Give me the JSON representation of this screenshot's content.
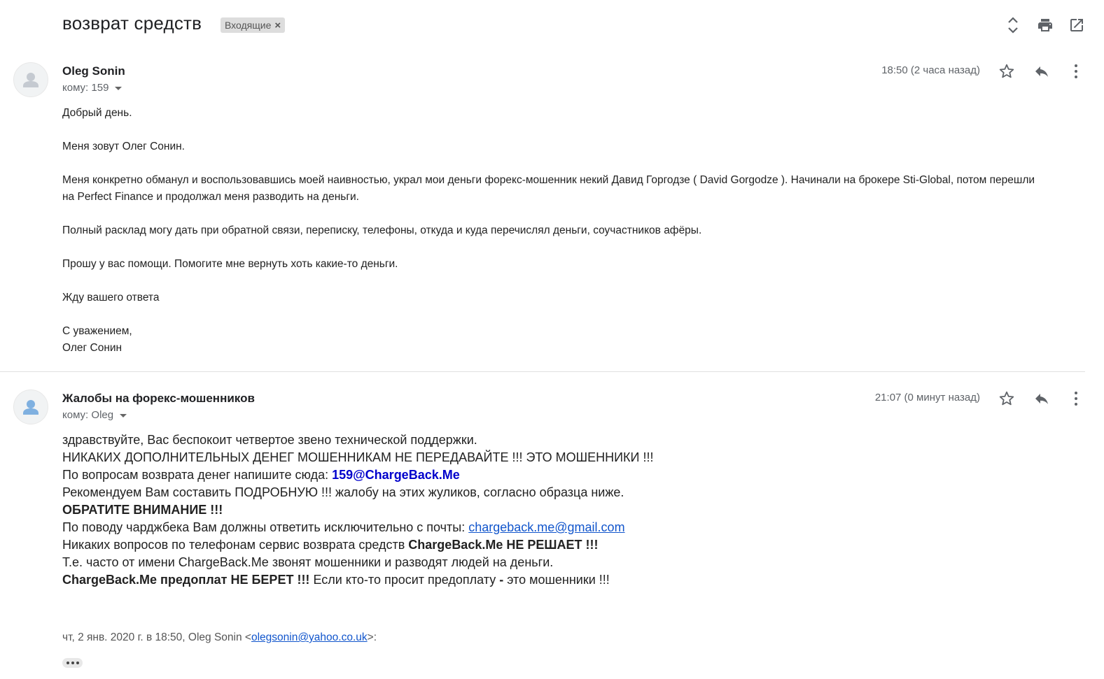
{
  "thread": {
    "subject": "возврат средств",
    "label": "Входящие",
    "label_remove": "×"
  },
  "header_icons": [
    "expand-collapse-icon",
    "print-icon",
    "open-in-new-window-icon"
  ],
  "messages": [
    {
      "sender": "Oleg Sonin",
      "to_prefix": "кому:",
      "to": "159",
      "time": "18:50 (2 часа назад)",
      "body": {
        "p1": "Добрый день.",
        "p2": "Меня зовут Олег Сонин.",
        "p3a": "Меня конкретно обманул и воспользовавшись моей наивностью, украл мои деньги форекс-мошенник некий  Давид Горгодзе ( David Gorgodze ). Начинали на брокере Sti-Global, потом перешли",
        "p3b": "на Perfect Finance и продолжал меня разводить на деньги.",
        "p4": "Полный расклад могу дать при обратной связи, переписку, телефоны, откуда и куда перечислял деньги, соучастников афёры.",
        "p5": "Прошу у  вас помощи. Помогите мне вернуть хоть какие-то деньги.",
        "p6": "Жду вашего ответа",
        "p7": "С уважением,",
        "p8": "Олег Сонин"
      }
    },
    {
      "sender": "Жалобы на форекс-мошенников",
      "to_prefix": "кому:",
      "to": "Oleg",
      "time": "21:07 (0 минут назад)",
      "body": {
        "l1": "здравствуйте, Вас беспокоит четвертое звено технической поддержки.",
        "l2": "НИКАКИХ ДОПОЛНИТЕЛЬНЫХ ДЕНЕГ МОШЕННИКАМ НЕ ПЕРЕДАВАЙТЕ !!! ЭТО МОШЕННИКИ !!!",
        "l3_text": "По вопросам возврата денег напишите сюда: ",
        "l3_email": "159@ChargeBack.Me",
        "l4": "Рекомендуем Вам составить ПОДРОБНУЮ !!! жалобу на этих жуликов, согласно образца ниже.",
        "l5": "ОБРАТИТЕ ВНИМАНИЕ !!!",
        "l6_text": "По поводу чарджбека Вам должны ответить исключительно с почты: ",
        "l6_email": "chargeback.me@gmail.com",
        "l7_text": "Никаких вопросов по телефонам сервис возврата средств ",
        "l7_bold": "ChargeBack.Me НЕ РЕШАЕТ !!!",
        "l8": "Т.е. часто от имени ChargeBack.Me звонят мошенники и разводят людей на деньги.",
        "l9_bold": "ChargeBack.Me предоплат НЕ БЕРЕТ !!!",
        "l9_text": " Если кто-то просит предоплату ",
        "l9_dash": "-",
        "l9_end": " это мошенники !!!"
      },
      "quote": {
        "prefix": "чт, 2 янв. 2020 г. в 18:50, Oleg Sonin <",
        "email": "olegsonin@yahoo.co.uk",
        "suffix": ">:"
      }
    }
  ]
}
